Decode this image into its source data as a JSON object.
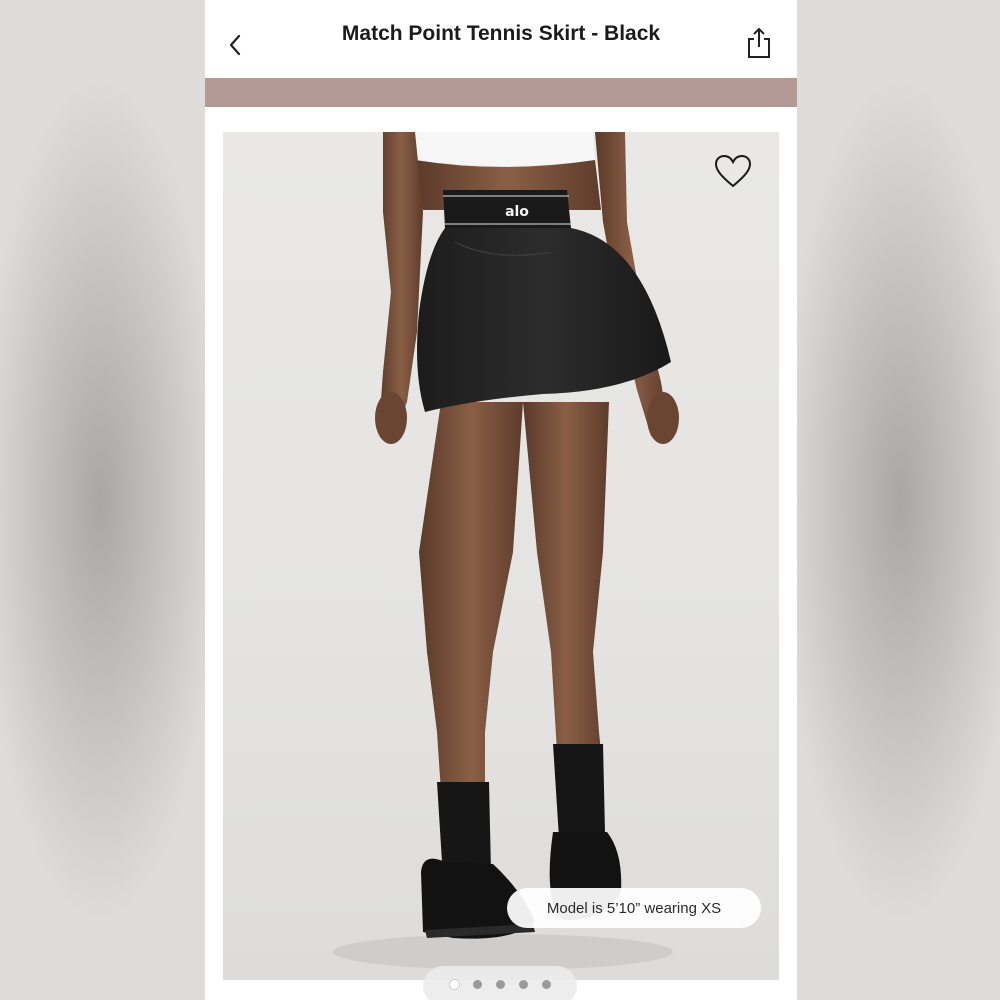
{
  "header": {
    "title": "Match Point Tennis Skirt - Black",
    "back_icon": "chevron-left-icon",
    "share_icon": "share-icon"
  },
  "promo_bar": {
    "color": "#b49a95"
  },
  "product_image": {
    "favorite_icon": "heart-icon",
    "brand_mark": "alo",
    "caption": "Model is 5’10” wearing XS"
  },
  "pager": {
    "count": 5,
    "active_index": 0
  }
}
